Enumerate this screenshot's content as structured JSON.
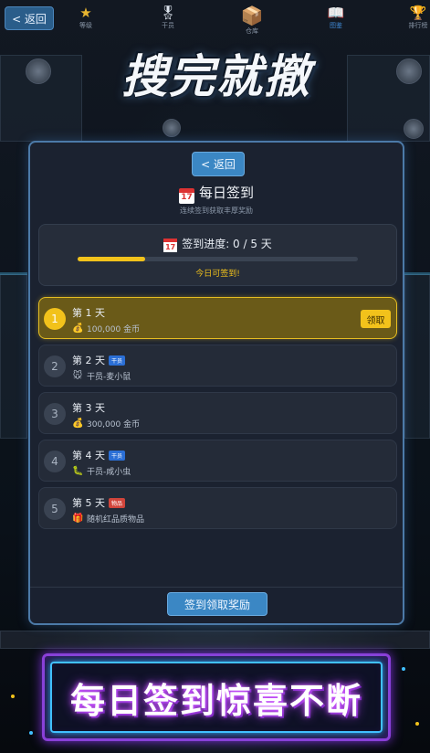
{
  "nav": {
    "back_label": "< 返回",
    "items": [
      {
        "label": "等级",
        "icon": "★"
      },
      {
        "label": "干员",
        "icon": "🎖"
      },
      {
        "label": "仓库",
        "icon": "📦"
      },
      {
        "label": "图鉴",
        "icon": "📖"
      },
      {
        "label": "排行榜",
        "icon": "🏆"
      }
    ]
  },
  "logo_text": "搜完就撤",
  "modal": {
    "back_label": "< 返回",
    "title": "每日签到",
    "calendar_day": "17",
    "subtitle": "连续签到获取丰厚奖励",
    "progress": {
      "label": "签到进度: 0 / 5 天",
      "value": 0.24,
      "today_text": "今日可签到!"
    },
    "days": [
      {
        "num": "1",
        "label": "第 1 天",
        "tag": "",
        "reward_icon": "💰",
        "reward": "100,000 金币",
        "active": true,
        "claim_label": "领取"
      },
      {
        "num": "2",
        "label": "第 2 天",
        "tag": "干员",
        "tag_color": "blue",
        "reward_icon": "🐭",
        "reward": "干员-麦小鼠",
        "active": false
      },
      {
        "num": "3",
        "label": "第 3 天",
        "tag": "",
        "reward_icon": "💰",
        "reward": "300,000 金币",
        "active": false
      },
      {
        "num": "4",
        "label": "第 4 天",
        "tag": "干员",
        "tag_color": "blue",
        "reward_icon": "🐛",
        "reward": "干员-咸小虫",
        "active": false
      },
      {
        "num": "5",
        "label": "第 5 天",
        "tag": "物品",
        "tag_color": "red",
        "reward_icon": "🎁",
        "reward": "随机红品质物品",
        "active": false
      }
    ],
    "footer_button": "签到领取奖励"
  },
  "banner_text": "每日签到惊喜不断",
  "colors": {
    "accent_gold": "#f2c21b",
    "button_blue": "#3b87c4",
    "neon_purple": "#8a3fd8",
    "neon_cyan": "#41c0ff"
  }
}
